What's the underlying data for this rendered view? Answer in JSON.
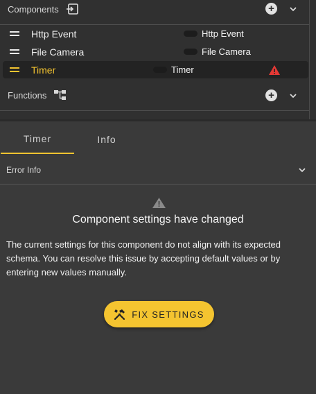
{
  "components": {
    "title": "Components",
    "icon": "import-icon",
    "items": [
      {
        "label": "Http Event",
        "toggle_label": "Http Event",
        "selected": false,
        "warning": false
      },
      {
        "label": "File Camera",
        "toggle_label": "File Camera",
        "selected": false,
        "warning": false
      },
      {
        "label": "Timer",
        "toggle_label": "Timer",
        "selected": true,
        "warning": true
      }
    ]
  },
  "functions": {
    "title": "Functions",
    "icon": "hierarchy-icon"
  },
  "tabs": [
    {
      "label": "Timer",
      "active": true
    },
    {
      "label": "Info",
      "active": false
    }
  ],
  "error_info": {
    "title": "Error Info",
    "heading": "Component settings have changed",
    "body": "The current settings for this component do not align with its expected schema. You can resolve this issue by accepting default values or by entering new values manually.",
    "button_label": "FIX SETTINGS"
  },
  "colors": {
    "accent": "#f4c430",
    "warning": "#e53935",
    "panel": "#303030",
    "background": "#3a3a3a"
  }
}
